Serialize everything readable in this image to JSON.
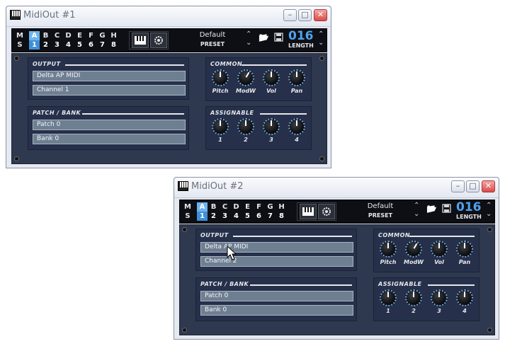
{
  "windows": [
    {
      "title": "MidiOut #1",
      "ms": [
        "M",
        "S"
      ],
      "slots": [
        {
          "letter": "A",
          "number": "1",
          "active": true
        },
        {
          "letter": "B",
          "number": "2"
        },
        {
          "letter": "C",
          "number": "3"
        },
        {
          "letter": "D",
          "number": "4"
        },
        {
          "letter": "E",
          "number": "5"
        },
        {
          "letter": "F",
          "number": "6"
        },
        {
          "letter": "G",
          "number": "7"
        },
        {
          "letter": "H",
          "number": "8"
        }
      ],
      "preset_name": "Default",
      "preset_label": "PRESET",
      "length_value": "016",
      "length_label": "LENGTH",
      "output_label": "OUTPUT",
      "output_device": "Delta AP MIDI",
      "output_channel": "Channel 1",
      "patch_bank_label": "PATCH / BANK",
      "patch": "Patch 0",
      "bank": "Bank 0",
      "common_label": "COMMON",
      "common_knobs": [
        "Pitch",
        "ModW",
        "Vol",
        "Pan"
      ],
      "assignable_label": "ASSIGNABLE",
      "assignable_knobs": [
        "1",
        "2",
        "3",
        "4"
      ]
    },
    {
      "title": "MidiOut #2",
      "ms": [
        "M",
        "S"
      ],
      "slots": [
        {
          "letter": "A",
          "number": "1",
          "active": true
        },
        {
          "letter": "B",
          "number": "2"
        },
        {
          "letter": "C",
          "number": "3"
        },
        {
          "letter": "D",
          "number": "4"
        },
        {
          "letter": "E",
          "number": "5"
        },
        {
          "letter": "F",
          "number": "6"
        },
        {
          "letter": "G",
          "number": "7"
        },
        {
          "letter": "H",
          "number": "8"
        }
      ],
      "preset_name": "Default",
      "preset_label": "PRESET",
      "length_value": "016",
      "length_label": "LENGTH",
      "output_label": "OUTPUT",
      "output_device": "Delta AP MIDI",
      "output_channel": "Channel 2",
      "patch_bank_label": "PATCH / BANK",
      "patch": "Patch 0",
      "bank": "Bank 0",
      "common_label": "COMMON",
      "common_knobs": [
        "Pitch",
        "ModW",
        "Vol",
        "Pan"
      ],
      "assignable_label": "ASSIGNABLE",
      "assignable_knobs": [
        "1",
        "2",
        "3",
        "4"
      ]
    }
  ],
  "window_buttons": {
    "minimize": "–",
    "maximize": "□",
    "close": "✕"
  },
  "icons": {
    "keyboard": "keyboard-icon",
    "settings": "gear-icon",
    "open": "folder-open-icon",
    "save": "save-icon",
    "cursor": "mouse-pointer-icon"
  },
  "colors": {
    "accent": "#3f8fd8",
    "length_digits": "#4ea3f0",
    "panel": "#2e3950"
  }
}
